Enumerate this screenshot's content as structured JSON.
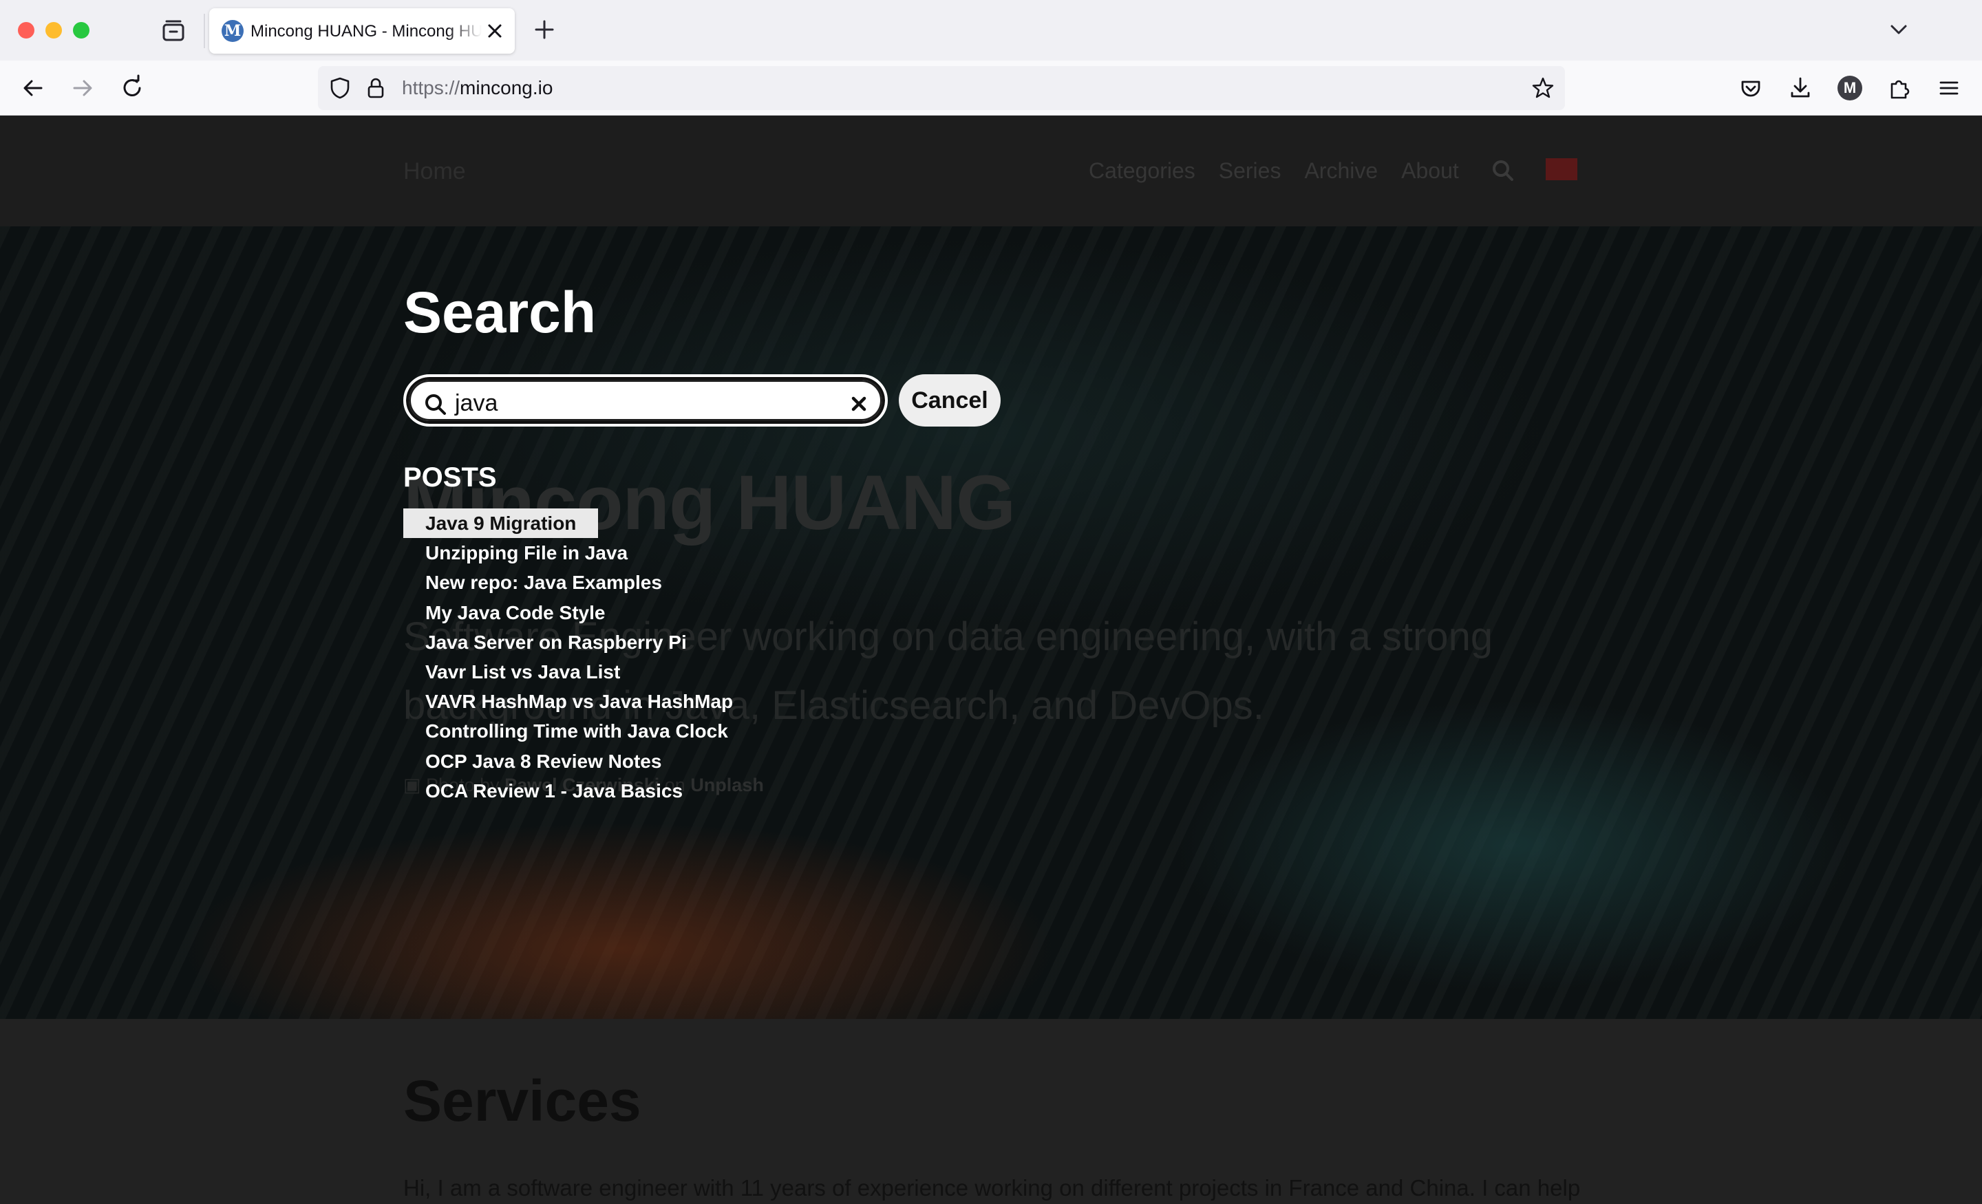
{
  "browser": {
    "tab_title": "Mincong HUANG - Mincong HUANG",
    "tab_favicon_letter": "M",
    "url_protocol": "https://",
    "url_host": "mincong.io",
    "profile_letter": "M"
  },
  "site_header": {
    "home_label": "Home",
    "nav": [
      "Categories",
      "Series",
      "Archive",
      "About"
    ]
  },
  "hero": {
    "title": "Mincong HUANG",
    "subtitle": "Software Engineer working on data engineering, with a strong background in Java, Elasticsearch, and DevOps.",
    "photo_prefix": "Photo by",
    "photo_author": "Pawel Czerwinski",
    "photo_on": "on",
    "photo_source": "Unplash"
  },
  "services": {
    "title": "Services",
    "text": "Hi, I am a software engineer with 11 years of experience working on different projects in France and China. I can help"
  },
  "search": {
    "title": "Search",
    "query": "java",
    "cancel_label": "Cancel",
    "posts_heading": "POSTS",
    "results": [
      "Java 9 Migration",
      "Unzipping File in Java",
      "New repo: Java Examples",
      "My Java Code Style",
      "Java Server on Raspberry Pi",
      "Vavr List vs Java List",
      "VAVR HashMap vs Java HashMap",
      "Controlling Time with Java Clock",
      "OCP Java 8 Review Notes",
      "OCA Review 1 - Java Basics"
    ],
    "active_index": 0
  }
}
